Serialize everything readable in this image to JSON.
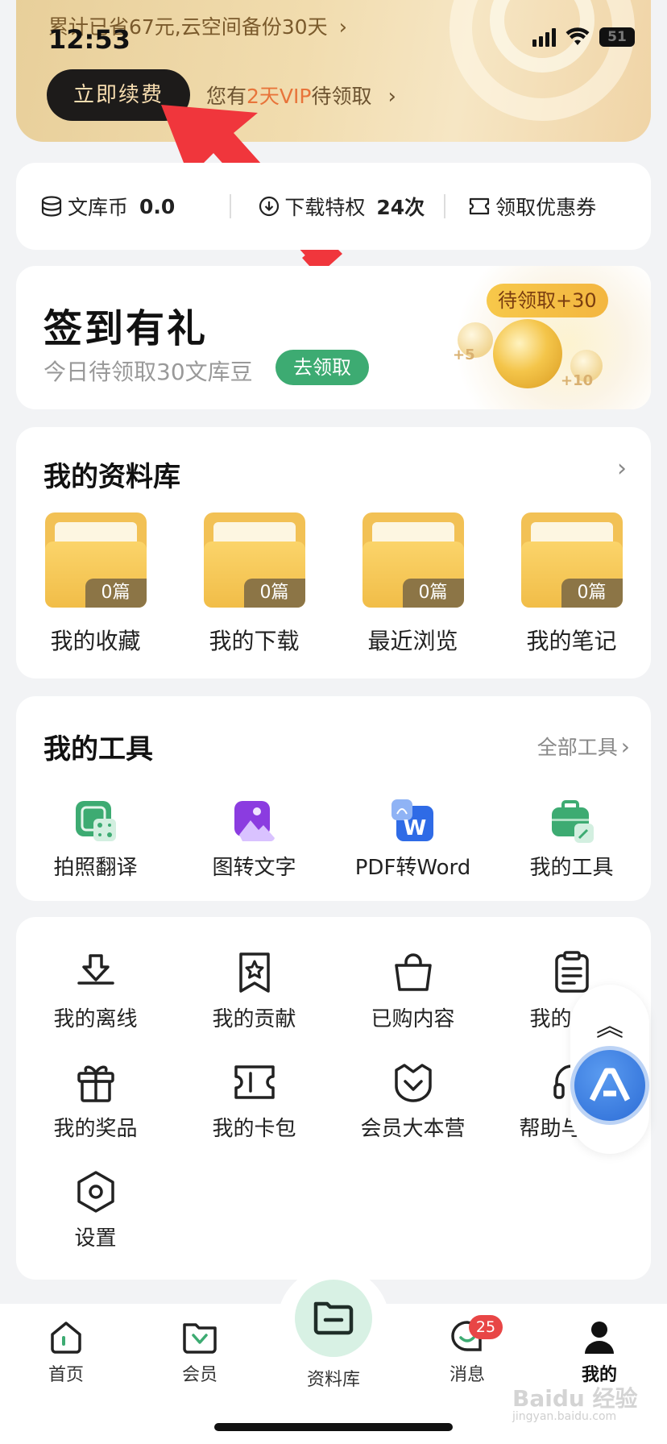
{
  "status_bar": {
    "time": "12:53",
    "battery": "51"
  },
  "vip": {
    "savings_text": "累计已省67元,云空间备份30天",
    "renew_label": "立即续费",
    "claim_prefix": "您有",
    "claim_highlight": "2天VIP",
    "claim_suffix": "待领取"
  },
  "stats": {
    "coins_label": "文库币",
    "coins_value": "0.0",
    "download_label": "下载特权",
    "download_value": "24次",
    "coupon_label": "领取优惠券"
  },
  "signin": {
    "title": "签到有礼",
    "subtitle": "今日待领取30文库豆",
    "button": "去领取",
    "badge": "待领取+30",
    "bonus_small_1": "+5",
    "bonus_small_2": "+10"
  },
  "library": {
    "title": "我的资料库",
    "folders": [
      {
        "label": "我的收藏",
        "count": "0篇"
      },
      {
        "label": "我的下载",
        "count": "0篇"
      },
      {
        "label": "最近浏览",
        "count": "0篇"
      },
      {
        "label": "我的笔记",
        "count": "0篇"
      }
    ]
  },
  "tools": {
    "title": "我的工具",
    "all_label": "全部工具",
    "items": [
      {
        "label": "拍照翻译",
        "icon": "photo-translate-icon"
      },
      {
        "label": "图转文字",
        "icon": "image-to-text-icon"
      },
      {
        "label": "PDF转Word",
        "icon": "pdf-to-word-icon"
      },
      {
        "label": "我的工具",
        "icon": "toolbox-icon"
      }
    ]
  },
  "menu": {
    "items": [
      {
        "label": "我的离线",
        "icon": "offline-download-icon"
      },
      {
        "label": "我的贡献",
        "icon": "contribution-star-icon"
      },
      {
        "label": "已购内容",
        "icon": "shopping-bag-icon"
      },
      {
        "label": "我的订单",
        "icon": "clipboard-icon"
      },
      {
        "label": "我的奖品",
        "icon": "gift-icon"
      },
      {
        "label": "我的卡包",
        "icon": "ticket-icon"
      },
      {
        "label": "会员大本营",
        "icon": "vip-camp-icon"
      },
      {
        "label": "帮助与反馈",
        "icon": "headset-icon"
      },
      {
        "label": "设置",
        "icon": "settings-hexagon-icon"
      }
    ]
  },
  "bottom_nav": {
    "items": [
      {
        "label": "首页"
      },
      {
        "label": "会员"
      },
      {
        "label": "资料库"
      },
      {
        "label": "消息",
        "badge": "25"
      },
      {
        "label": "我的"
      }
    ]
  },
  "watermark": {
    "main": "Baidu 经验",
    "sub": "jingyan.baidu.com"
  },
  "colors": {
    "accent_green": "#3dab72",
    "vip_gold": "#f1dcae",
    "highlight_orange": "#e8743a",
    "badge_red": "#e84646"
  }
}
